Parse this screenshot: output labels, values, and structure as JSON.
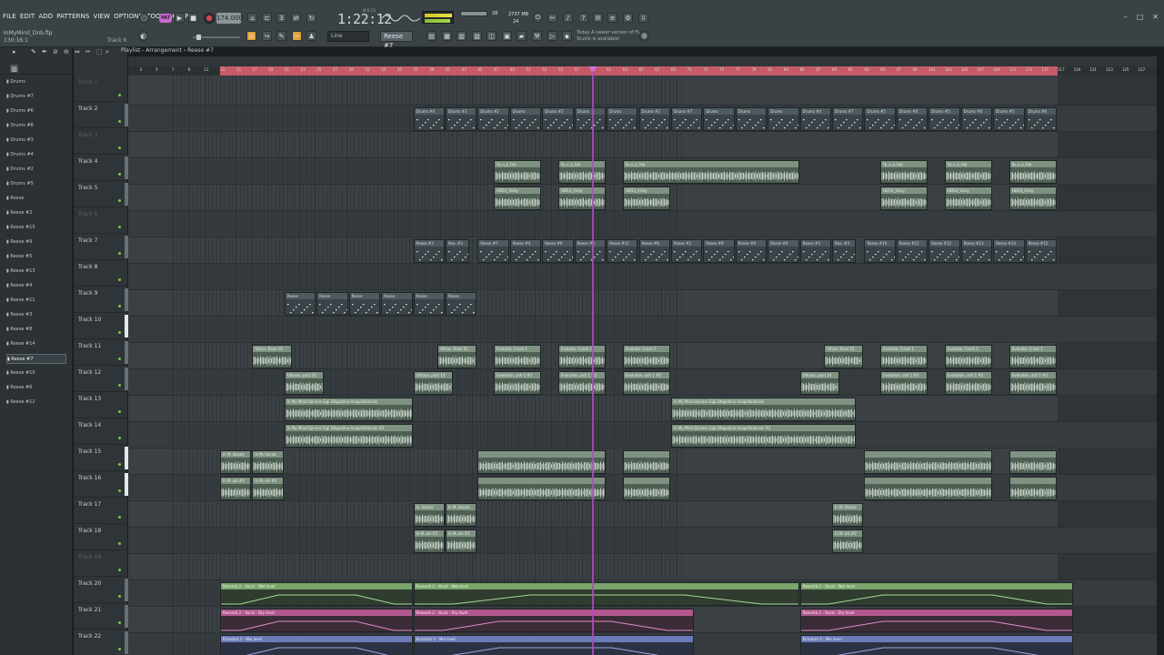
{
  "menu": [
    "FILE",
    "EDIT",
    "ADD",
    "PATTERNS",
    "VIEW",
    "OPTIONS",
    "TOOLS",
    "HELP"
  ],
  "project": {
    "name": "InMyMind_Dnb.flp",
    "position": "130:16:1",
    "track_hint": "Track 6"
  },
  "transport": {
    "pattern_mode_label": "PAT",
    "tempo": "174.000",
    "time": "1:22:12",
    "time_sub": "M:S:CS",
    "cpu": "28",
    "memory": "2737 MB",
    "polyphony": "24"
  },
  "toolbar": {
    "snap": "Line",
    "pattern_selector": "Reese #7",
    "news": "Today A newer version of FL Studio is available!"
  },
  "playlist": {
    "title": "Playlist - Arrangement › Reese #7"
  },
  "browser": {
    "items": [
      "Drums",
      "Drums #7",
      "Drums #6",
      "Drums #8",
      "Drums #3",
      "Drums #4",
      "Drums #2",
      "Drums #5",
      "Reese",
      "Reese #2",
      "Reese #15",
      "Reese #9",
      "Reese #5",
      "Reese #13",
      "Reese #4",
      "Reese #11",
      "Reese #3",
      "Reese #8",
      "Reese #14",
      "Reese #7",
      "Reese #10",
      "Reese #6",
      "Reese #12"
    ],
    "selected_index": 19
  },
  "ruler": {
    "bars": [
      "1",
      "3",
      "5",
      "7",
      "9",
      "11",
      "13",
      "15",
      "17",
      "19",
      "21",
      "23",
      "25",
      "27",
      "29",
      "31",
      "33",
      "35",
      "37",
      "39",
      "41",
      "43",
      "45",
      "47",
      "49",
      "51",
      "53",
      "55",
      "57",
      "59",
      "61",
      "63",
      "65",
      "67",
      "69",
      "71",
      "73",
      "75",
      "77",
      "79",
      "81",
      "83",
      "85",
      "87",
      "89",
      "91",
      "93",
      "95",
      "97",
      "99",
      "101",
      "103",
      "105",
      "107",
      "109",
      "111",
      "113",
      "115",
      "117",
      "119",
      "121",
      "123",
      "125",
      "127",
      "129"
    ]
  },
  "tracks": [
    {
      "name": "Track 1",
      "dim": true,
      "bar": "none"
    },
    {
      "name": "Track 2",
      "dim": false,
      "bar": "g"
    },
    {
      "name": "Track 3",
      "dim": true,
      "bar": "none"
    },
    {
      "name": "Track 4",
      "dim": false,
      "bar": "g"
    },
    {
      "name": "Track 5",
      "dim": false,
      "bar": "g"
    },
    {
      "name": "Track 6",
      "dim": true,
      "bar": "none"
    },
    {
      "name": "Track 7",
      "dim": false,
      "bar": "g"
    },
    {
      "name": "Track 8",
      "dim": false,
      "bar": "none"
    },
    {
      "name": "Track 9",
      "dim": false,
      "bar": "g"
    },
    {
      "name": "Track 10",
      "dim": false,
      "bar": "w"
    },
    {
      "name": "Track 11",
      "dim": false,
      "bar": "g"
    },
    {
      "name": "Track 12",
      "dim": false,
      "bar": "g"
    },
    {
      "name": "Track 13",
      "dim": false,
      "bar": "none"
    },
    {
      "name": "Track 14",
      "dim": false,
      "bar": "none"
    },
    {
      "name": "Track 15",
      "dim": false,
      "bar": "w"
    },
    {
      "name": "Track 16",
      "dim": false,
      "bar": "w"
    },
    {
      "name": "Track 17",
      "dim": false,
      "bar": "none"
    },
    {
      "name": "Track 18",
      "dim": false,
      "bar": "none"
    },
    {
      "name": "Track 19",
      "dim": true,
      "bar": "none"
    },
    {
      "name": "Track 20",
      "dim": false,
      "bar": "g"
    },
    {
      "name": "Track 21",
      "dim": false,
      "bar": "g"
    },
    {
      "name": "Track 22",
      "dim": false,
      "bar": "g"
    }
  ],
  "clips": [
    {
      "t": 1,
      "s": 37,
      "e": 41,
      "k": "pat",
      "n": "Drums #4"
    },
    {
      "t": 1,
      "s": 41,
      "e": 45,
      "k": "pat",
      "n": "Drums #3"
    },
    {
      "t": 1,
      "s": 45,
      "e": 49,
      "k": "pat",
      "n": "Drums #2"
    },
    {
      "t": 1,
      "s": 49,
      "e": 53,
      "k": "pat",
      "n": "Drums"
    },
    {
      "t": 1,
      "s": 53,
      "e": 57,
      "k": "pat",
      "n": "Drums #2"
    },
    {
      "t": 1,
      "s": 57,
      "e": 61,
      "k": "pat",
      "n": "Drums"
    },
    {
      "t": 1,
      "s": 61,
      "e": 65,
      "k": "pat",
      "n": "Drums"
    },
    {
      "t": 1,
      "s": 65,
      "e": 69,
      "k": "pat",
      "n": "Drums #2"
    },
    {
      "t": 1,
      "s": 69,
      "e": 73,
      "k": "pat",
      "n": "Drums #7"
    },
    {
      "t": 1,
      "s": 73,
      "e": 77,
      "k": "pat",
      "n": "Drums"
    },
    {
      "t": 1,
      "s": 77,
      "e": 81,
      "k": "pat",
      "n": "Drums"
    },
    {
      "t": 1,
      "s": 81,
      "e": 85,
      "k": "pat",
      "n": "Drums"
    },
    {
      "t": 1,
      "s": 85,
      "e": 89,
      "k": "pat",
      "n": "Drums #4"
    },
    {
      "t": 1,
      "s": 89,
      "e": 93,
      "k": "pat",
      "n": "Drums #7"
    },
    {
      "t": 1,
      "s": 93,
      "e": 97,
      "k": "pat",
      "n": "Drums #5"
    },
    {
      "t": 1,
      "s": 97,
      "e": 101,
      "k": "pat",
      "n": "Drums #6"
    },
    {
      "t": 1,
      "s": 101,
      "e": 105,
      "k": "pat",
      "n": "Drums #5"
    },
    {
      "t": 1,
      "s": 105,
      "e": 109,
      "k": "pat",
      "n": "Drums #6"
    },
    {
      "t": 1,
      "s": 109,
      "e": 113,
      "k": "pat",
      "n": "Drums #5"
    },
    {
      "t": 1,
      "s": 113,
      "e": 117,
      "k": "pat",
      "n": "Drums #8"
    },
    {
      "t": 3,
      "s": 47,
      "e": 53,
      "k": "aud",
      "n": "tp_u_y_top"
    },
    {
      "t": 3,
      "s": 55,
      "e": 61,
      "k": "aud",
      "n": "tp_u_y_top"
    },
    {
      "t": 3,
      "s": 63,
      "e": 85,
      "k": "aud",
      "n": "tp_u_y_top"
    },
    {
      "t": 3,
      "s": 95,
      "e": 101,
      "k": "aud",
      "n": "tp_u_y_top"
    },
    {
      "t": 3,
      "s": 103,
      "e": 109,
      "k": "aud",
      "n": "tp_u_y_top"
    },
    {
      "t": 3,
      "s": 111,
      "e": 117,
      "k": "aud",
      "n": "tp_u_y_top"
    },
    {
      "t": 4,
      "s": 47,
      "e": 53,
      "k": "aud",
      "n": "HD53_Vicky"
    },
    {
      "t": 4,
      "s": 55,
      "e": 61,
      "k": "aud",
      "n": "HD53_Vicky"
    },
    {
      "t": 4,
      "s": 63,
      "e": 69,
      "k": "aud",
      "n": "HD53_Vicky"
    },
    {
      "t": 4,
      "s": 95,
      "e": 101,
      "k": "aud",
      "n": "HD53_Vicky"
    },
    {
      "t": 4,
      "s": 103,
      "e": 109,
      "k": "aud",
      "n": "HD53_Vicky"
    },
    {
      "t": 4,
      "s": 111,
      "e": 117,
      "k": "aud",
      "n": "HD53_Vicky"
    },
    {
      "t": 6,
      "s": 37,
      "e": 41,
      "k": "pat",
      "n": "Reese #3"
    },
    {
      "t": 6,
      "s": 41,
      "e": 44,
      "k": "pat",
      "n": "Ree..#3"
    },
    {
      "t": 6,
      "s": 45,
      "e": 49,
      "k": "pat",
      "n": "Reese #7"
    },
    {
      "t": 6,
      "s": 49,
      "e": 53,
      "k": "pat",
      "n": "Reese #4"
    },
    {
      "t": 6,
      "s": 53,
      "e": 57,
      "k": "pat",
      "n": "Reese #6"
    },
    {
      "t": 6,
      "s": 57,
      "e": 61,
      "k": "pat",
      "n": "Reese #5"
    },
    {
      "t": 6,
      "s": 61,
      "e": 65,
      "k": "pat",
      "n": "Reese #11"
    },
    {
      "t": 6,
      "s": 65,
      "e": 69,
      "k": "pat",
      "n": "Reese #8"
    },
    {
      "t": 6,
      "s": 69,
      "e": 73,
      "k": "pat",
      "n": "Reese #2"
    },
    {
      "t": 6,
      "s": 73,
      "e": 77,
      "k": "pat",
      "n": "Reese #9"
    },
    {
      "t": 6,
      "s": 77,
      "e": 81,
      "k": "pat",
      "n": "Reese #9"
    },
    {
      "t": 6,
      "s": 81,
      "e": 85,
      "k": "pat",
      "n": "Reese #9"
    },
    {
      "t": 6,
      "s": 85,
      "e": 89,
      "k": "pat",
      "n": "Reese #3"
    },
    {
      "t": 6,
      "s": 89,
      "e": 92,
      "k": "pat",
      "n": "Ree..#3"
    },
    {
      "t": 6,
      "s": 93,
      "e": 97,
      "k": "pat",
      "n": "Reese #10"
    },
    {
      "t": 6,
      "s": 97,
      "e": 101,
      "k": "pat",
      "n": "Reese #11"
    },
    {
      "t": 6,
      "s": 101,
      "e": 105,
      "k": "pat",
      "n": "Reese #12"
    },
    {
      "t": 6,
      "s": 105,
      "e": 109,
      "k": "pat",
      "n": "Reese #13"
    },
    {
      "t": 6,
      "s": 109,
      "e": 113,
      "k": "pat",
      "n": "Reese #14"
    },
    {
      "t": 6,
      "s": 113,
      "e": 117,
      "k": "pat",
      "n": "Reese #15"
    },
    {
      "t": 8,
      "s": 21,
      "e": 25,
      "k": "pat",
      "n": "Reese"
    },
    {
      "t": 8,
      "s": 25,
      "e": 29,
      "k": "pat",
      "n": "Reese"
    },
    {
      "t": 8,
      "s": 29,
      "e": 33,
      "k": "pat",
      "n": "Reese"
    },
    {
      "t": 8,
      "s": 33,
      "e": 37,
      "k": "pat",
      "n": "Reese"
    },
    {
      "t": 8,
      "s": 37,
      "e": 41,
      "k": "pat",
      "n": "Reese"
    },
    {
      "t": 8,
      "s": 41,
      "e": 45,
      "k": "pat",
      "n": "Reese"
    },
    {
      "t": 10,
      "s": 17,
      "e": 22,
      "k": "aud",
      "n": "Ultras..Riser 01"
    },
    {
      "t": 10,
      "s": 40,
      "e": 45,
      "k": "aud",
      "n": "Ultras..Riser 01"
    },
    {
      "t": 10,
      "s": 47,
      "e": 53,
      "k": "aud",
      "n": "Evolutio..Crash 1"
    },
    {
      "t": 10,
      "s": 55,
      "e": 61,
      "k": "aud",
      "n": "Evolutio..Crash 1"
    },
    {
      "t": 10,
      "s": 63,
      "e": 69,
      "k": "aud",
      "n": "Evolutio..Crash 1"
    },
    {
      "t": 10,
      "s": 88,
      "e": 93,
      "k": "aud",
      "n": "Ultras..Riser 01"
    },
    {
      "t": 10,
      "s": 95,
      "e": 101,
      "k": "aud",
      "n": "Evolutio..Crash 1"
    },
    {
      "t": 10,
      "s": 103,
      "e": 109,
      "k": "aud",
      "n": "Evolutio..Crash 1"
    },
    {
      "t": 10,
      "s": 111,
      "e": 117,
      "k": "aud",
      "n": "Evolutio..Crash 1"
    },
    {
      "t": 11,
      "s": 21,
      "e": 26,
      "k": "aud",
      "n": "Ultraso..pact 14"
    },
    {
      "t": 11,
      "s": 37,
      "e": 42,
      "k": "aud",
      "n": "Ultraso..pact 14"
    },
    {
      "t": 11,
      "s": 47,
      "e": 53,
      "k": "aud",
      "n": "Evolution..ash 1 #2"
    },
    {
      "t": 11,
      "s": 55,
      "e": 61,
      "k": "aud",
      "n": "Evolution..ash 1 #2"
    },
    {
      "t": 11,
      "s": 63,
      "e": 69,
      "k": "aud",
      "n": "Evolution..ash 1 #2"
    },
    {
      "t": 11,
      "s": 85,
      "e": 90,
      "k": "aud",
      "n": "Ultraso..pact 14"
    },
    {
      "t": 11,
      "s": 95,
      "e": 101,
      "k": "aud",
      "n": "Evolution..ash 1 #2"
    },
    {
      "t": 11,
      "s": 103,
      "e": 109,
      "k": "aud",
      "n": "Evolution..ash 1 #2"
    },
    {
      "t": 11,
      "s": 111,
      "e": 117,
      "k": "aud",
      "n": "Evolution..ash 1 #2"
    },
    {
      "t": 12,
      "s": 21,
      "e": 37,
      "k": "aud",
      "n": "In My Mind Dynoro Gigi DAgostino AcapellaVocals"
    },
    {
      "t": 12,
      "s": 69,
      "e": 92,
      "k": "aud",
      "n": "In My Mind Dynoro Gigi DAgostino AcapellaVocals"
    },
    {
      "t": 13,
      "s": 21,
      "e": 37,
      "k": "aud",
      "n": "In My Mind Dynoro Gigi DAgostino AcapellaVocals #2"
    },
    {
      "t": 13,
      "s": 69,
      "e": 92,
      "k": "aud",
      "n": "In My Mind Dynoro Gigi DAgostino AcapellaVocals #2"
    },
    {
      "t": 14,
      "s": 13,
      "e": 17,
      "k": "aud",
      "n": "In M..Vocals"
    },
    {
      "t": 14,
      "s": 17,
      "e": 21,
      "k": "aud",
      "n": "In M..Vocals"
    },
    {
      "t": 14,
      "s": 45,
      "e": 61,
      "k": "aud",
      "n": ""
    },
    {
      "t": 14,
      "s": 63,
      "e": 69,
      "k": "aud",
      "n": ""
    },
    {
      "t": 14,
      "s": 93,
      "e": 109,
      "k": "aud",
      "n": ""
    },
    {
      "t": 14,
      "s": 111,
      "e": 117,
      "k": "aud",
      "n": ""
    },
    {
      "t": 15,
      "s": 13,
      "e": 17,
      "k": "aud",
      "n": "In M..als #2"
    },
    {
      "t": 15,
      "s": 17,
      "e": 21,
      "k": "aud",
      "n": "In M..als #2"
    },
    {
      "t": 15,
      "s": 45,
      "e": 61,
      "k": "aud",
      "n": ""
    },
    {
      "t": 15,
      "s": 63,
      "e": 69,
      "k": "aud",
      "n": ""
    },
    {
      "t": 15,
      "s": 93,
      "e": 109,
      "k": "aud",
      "n": ""
    },
    {
      "t": 15,
      "s": 111,
      "e": 117,
      "k": "aud",
      "n": ""
    },
    {
      "t": 16,
      "s": 37,
      "e": 41,
      "k": "aud",
      "n": "In..Vocals"
    },
    {
      "t": 16,
      "s": 41,
      "e": 45,
      "k": "aud",
      "n": "In M..Vocals"
    },
    {
      "t": 16,
      "s": 89,
      "e": 93,
      "k": "aud",
      "n": "In M..Vocals"
    },
    {
      "t": 17,
      "s": 37,
      "e": 41,
      "k": "aud",
      "n": "In M..als #2"
    },
    {
      "t": 17,
      "s": 41,
      "e": 45,
      "k": "aud",
      "n": "In M..als #2"
    },
    {
      "t": 17,
      "s": 89,
      "e": 93,
      "k": "aud",
      "n": "In M..als #2"
    },
    {
      "t": 19,
      "s": 13,
      "e": 37,
      "k": "autog",
      "n": "Reeverb 2 - Vocal - Wet level"
    },
    {
      "t": 19,
      "s": 37,
      "e": 85,
      "k": "autog",
      "n": "Reeverb 2 - Vocal - Wet level"
    },
    {
      "t": 19,
      "s": 85,
      "e": 119,
      "k": "autog",
      "n": "Reeverb 2 - Vocal - Wet level"
    },
    {
      "t": 20,
      "s": 13,
      "e": 37,
      "k": "autop",
      "n": "Reeverb 2 - Vocal - Dry level"
    },
    {
      "t": 20,
      "s": 37,
      "e": 72,
      "k": "autop",
      "n": "Reeverb 2 - Vocal - Dry level"
    },
    {
      "t": 20,
      "s": 85,
      "e": 119,
      "k": "autop",
      "n": "Reeverb 2 - Vocal - Dry level"
    },
    {
      "t": 21,
      "s": 13,
      "e": 37,
      "k": "autob",
      "n": "Kickstart 2 - Mix level"
    },
    {
      "t": 21,
      "s": 37,
      "e": 72,
      "k": "autob",
      "n": "Kickstart 2 - Mix level"
    },
    {
      "t": 21,
      "s": 85,
      "e": 119,
      "k": "autob",
      "n": "Kickstart 2 - Mix level"
    }
  ],
  "colors": {
    "playhead": "#b24bc3",
    "ruler_loop": "#c65a67",
    "track_dot": "#7ec73f"
  }
}
